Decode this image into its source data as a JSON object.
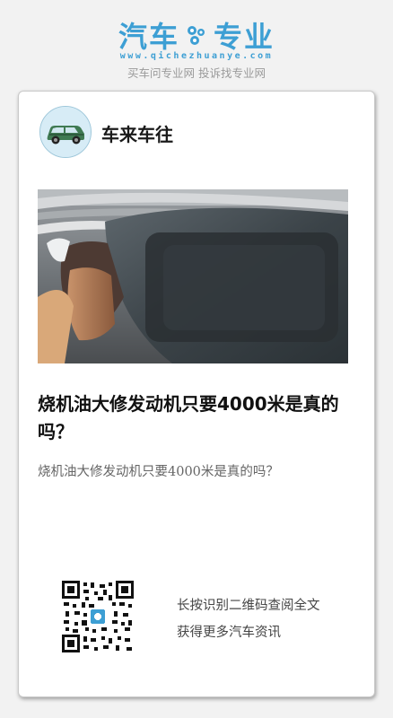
{
  "brand": {
    "name_left": "汽车",
    "name_right": "专业",
    "url": "www.qichezhuanye.com",
    "slogan": "买车问专业网 投诉找专业网"
  },
  "author": {
    "name": "车来车往",
    "avatar_icon": "car-icon"
  },
  "article": {
    "title": "烧机油大修发动机只要4000米是真的吗？",
    "summary": "烧机油大修发动机只要4000米是真的吗？",
    "cover_icon": "piston-photo"
  },
  "qr": {
    "line1": "长按识别二维码查阅全文",
    "line2": "获得更多汽车资讯"
  },
  "colors": {
    "accent": "#3d9fd4",
    "card_bg": "#ffffff",
    "page_bg": "#f2f2f2"
  }
}
